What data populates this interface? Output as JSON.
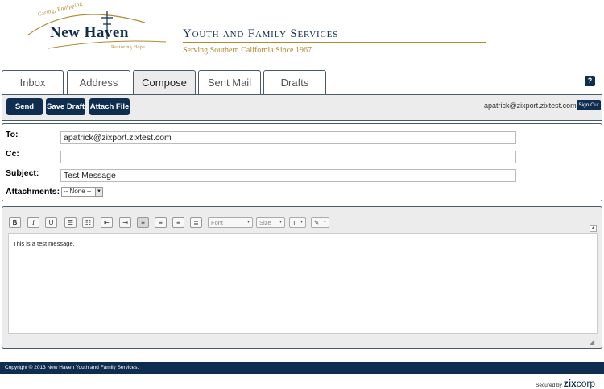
{
  "header": {
    "logo_top_text": "Caring, Equipping",
    "logo_name": "New Haven",
    "logo_bottom_text": "Restoring Hope",
    "org_title": "Youth and Family Services",
    "tagline": "Serving Southern California Since 1967"
  },
  "tabs": [
    {
      "label": "Inbox",
      "active": false
    },
    {
      "label": "Address",
      "active": false
    },
    {
      "label": "Compose",
      "active": true
    },
    {
      "label": "Sent Mail",
      "active": false
    },
    {
      "label": "Drafts",
      "active": false
    }
  ],
  "help_label": "?",
  "toolbar": {
    "send_label": "Send",
    "save_draft_label": "Save Draft",
    "attach_file_label": "Attach File",
    "user_email": "apatrick@zixport.zixtest.com",
    "sign_out_label": "Sign Out"
  },
  "compose": {
    "to_label": "To:",
    "to_value": "apatrick@zixport.zixtest.com",
    "cc_label": "Cc:",
    "cc_value": "",
    "subject_label": "Subject:",
    "subject_value": "Test Message",
    "attachments_label": "Attachments:",
    "attachments_selected": "-- None --"
  },
  "editor": {
    "bold": "B",
    "italic": "I",
    "underline": "U",
    "font_placeholder": "Font",
    "size_placeholder": "Size",
    "body_text": "This is a test message."
  },
  "footer": {
    "copyright": "Copyright © 2013 New Haven Youth and Family Services.",
    "secured_by": "Secured by",
    "brand_zix": "zix",
    "brand_corp": "corp"
  },
  "colors": {
    "navy": "#0f2d4f",
    "gold": "#b08a2e",
    "panel_gray": "#ececec"
  }
}
